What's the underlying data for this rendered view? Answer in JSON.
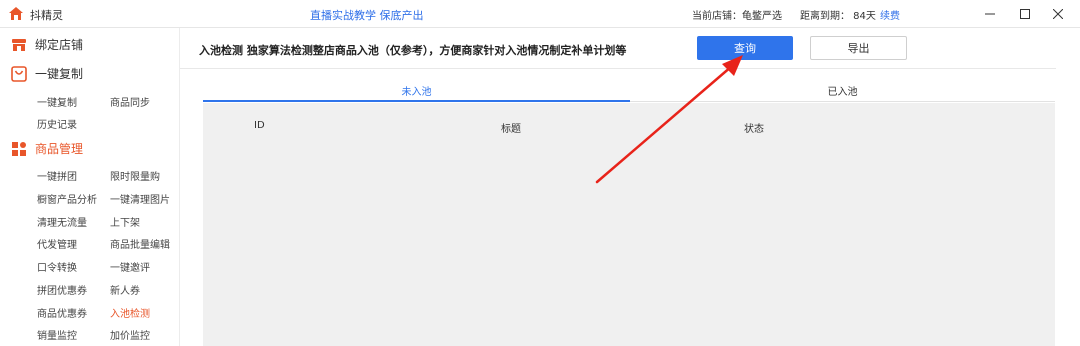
{
  "app": {
    "name": "抖精灵",
    "promo": "直播实战教学 保底产出",
    "store": "当前店铺：龟鳖严选",
    "expire": "距离到期：  84天",
    "renew": "续费"
  },
  "sidebar": {
    "bind_store": "绑定店铺",
    "copy_group": {
      "label": "一键复制",
      "items": [
        "一键复制",
        "商品同步",
        "历史记录"
      ]
    },
    "goods_group": {
      "label": "商品管理",
      "items": [
        "一键拼团",
        "限时限量购",
        "橱窗产品分析",
        "一键清理图片",
        "清理无流量",
        "上下架",
        "代发管理",
        "商品批量编辑",
        "口令转换",
        "一键邀评",
        "拼团优惠券",
        "新人券",
        "商品优惠券",
        "入池检测",
        "销量监控",
        "加价监控"
      ]
    }
  },
  "main": {
    "headline": "入池检测  独家算法检测整店商品入池（仅参考），方便商家针对入池情况制定补单计划等",
    "query_button": "查询",
    "export_button": "导出",
    "tabs": [
      "未入池",
      "已入池"
    ],
    "columns": [
      "ID",
      "标题",
      "状态"
    ]
  },
  "colors": {
    "accent_blue": "#2f74eb",
    "accent_orange": "#e8562a",
    "arrow_red": "#e8231a"
  }
}
